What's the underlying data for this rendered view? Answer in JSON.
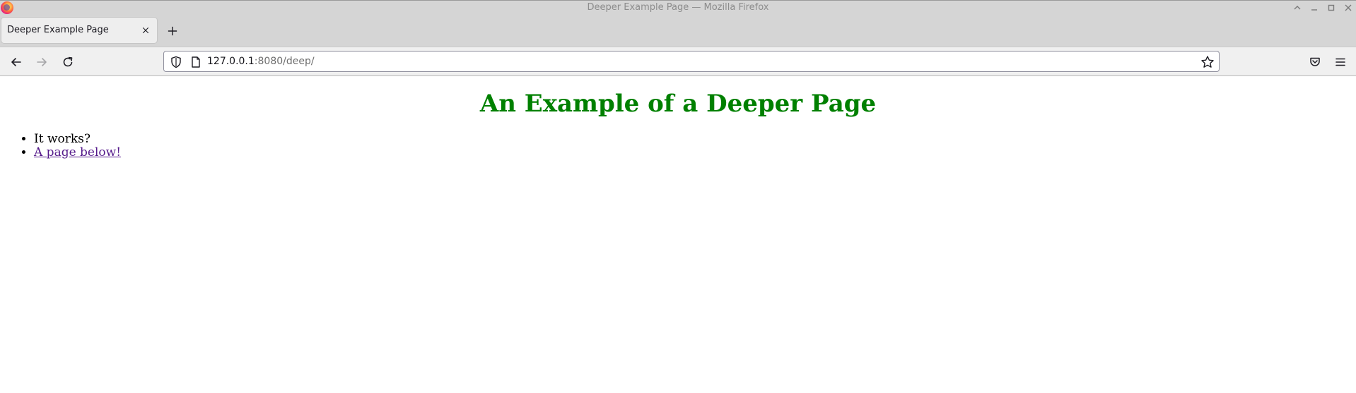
{
  "window": {
    "title": "Deeper Example Page — Mozilla Firefox"
  },
  "tabs": [
    {
      "label": "Deeper Example Page",
      "active": true
    }
  ],
  "navbar": {
    "url_host": "127.0.0.1",
    "url_rest": ":8080/deep/"
  },
  "page": {
    "heading": "An Example of a Deeper Page",
    "heading_color": "#008000",
    "list": [
      {
        "text": "It works?",
        "link": false
      },
      {
        "text": "A page below!",
        "link": true
      }
    ],
    "link_color": "#551a8b"
  },
  "icons": {
    "app": "firefox-logo",
    "minimize": "minimize-icon",
    "maximize": "maximize-icon",
    "close": "close-icon"
  }
}
